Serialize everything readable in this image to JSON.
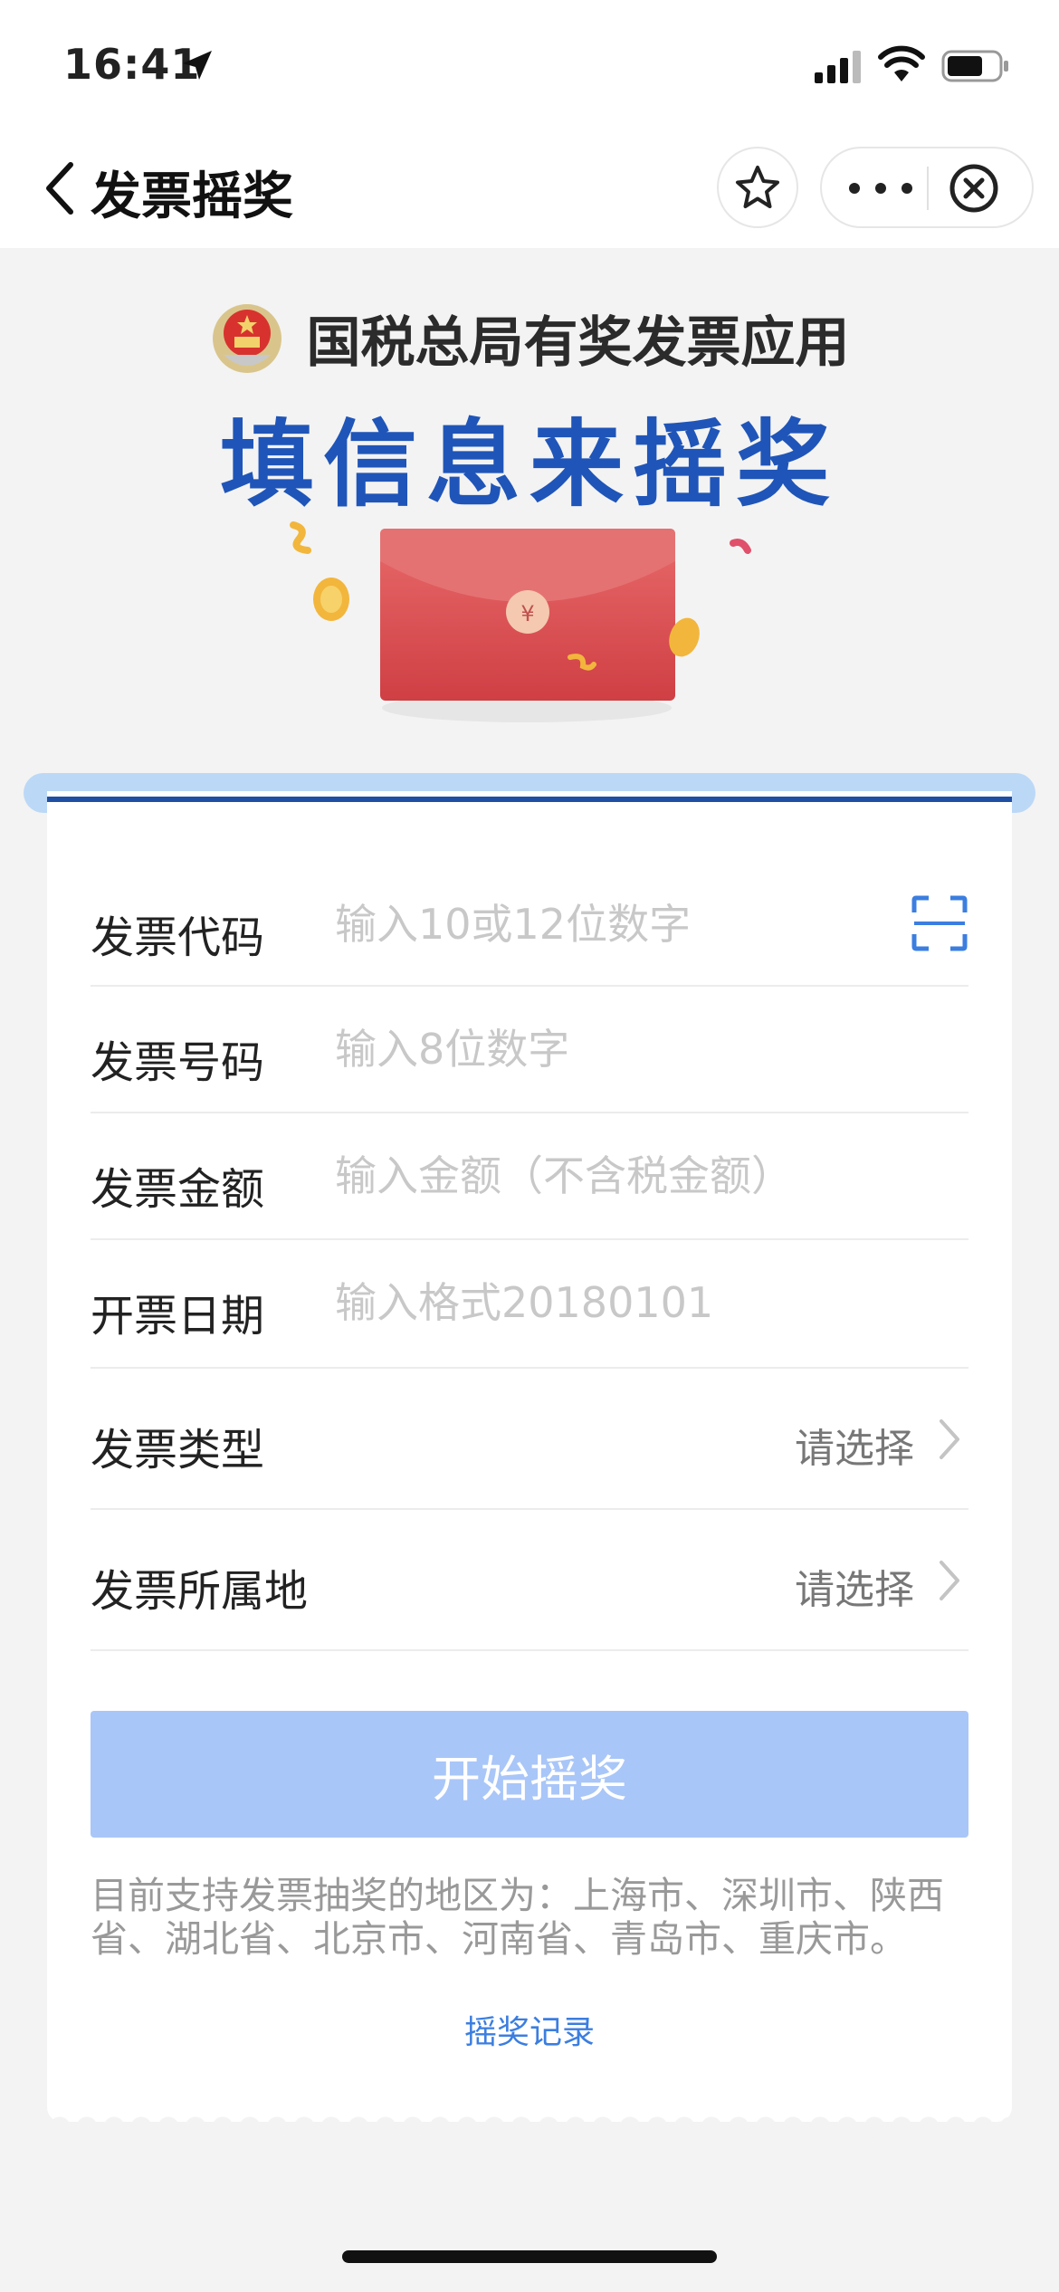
{
  "status_bar": {
    "time": "16:41"
  },
  "nav": {
    "title": "发票摇奖"
  },
  "header": {
    "subtitle": "国税总局有奖发票应用",
    "headline": "填信息来摇奖"
  },
  "form": {
    "invoice_code": {
      "label": "发票代码",
      "placeholder": "输入10或12位数字",
      "value": ""
    },
    "invoice_number": {
      "label": "发票号码",
      "placeholder": "输入8位数字",
      "value": ""
    },
    "invoice_amount": {
      "label": "发票金额",
      "placeholder": "输入金额（不含税金额）",
      "value": ""
    },
    "issue_date": {
      "label": "开票日期",
      "placeholder": "输入格式20180101",
      "value": ""
    },
    "invoice_type": {
      "label": "发票类型",
      "value": "请选择"
    },
    "invoice_region": {
      "label": "发票所属地",
      "value": "请选择"
    }
  },
  "start_button": "开始摇奖",
  "notice": "目前支持发票抽奖的地区为：上海市、深圳市、陕西省、湖北省、北京市、河南省、青岛市、重庆市。",
  "record_link": "摇奖记录",
  "colors": {
    "accent_blue": "#1f55b8",
    "button_disabled": "#a9c6f8",
    "envelope_red": "#d9454a",
    "link_blue": "#3b7ee0"
  }
}
